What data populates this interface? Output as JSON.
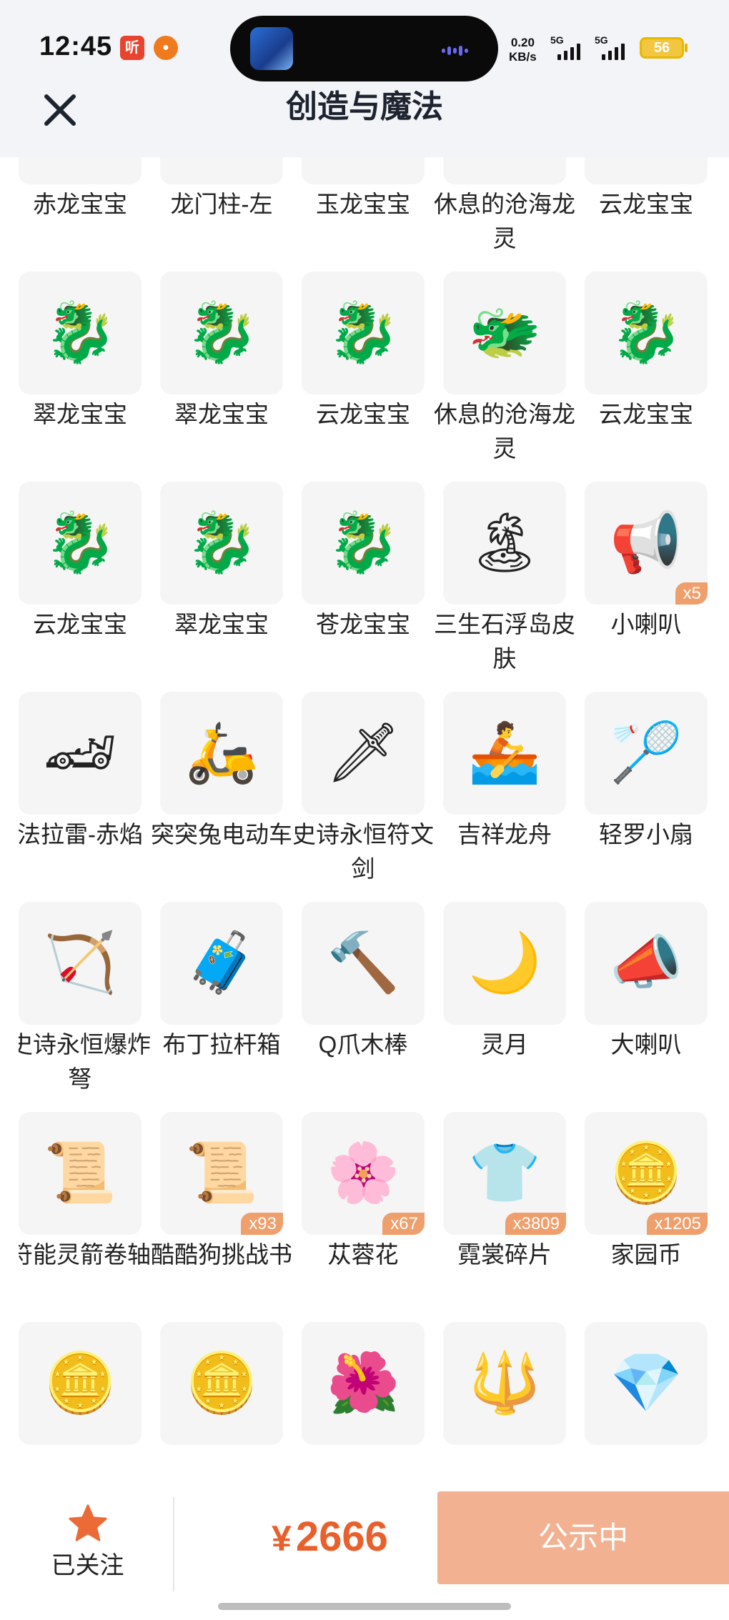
{
  "status_bar": {
    "time": "12:45",
    "badge1": "听",
    "network_speed": "0.20",
    "network_unit": "KB/s",
    "sim1": "5G",
    "sim2": "5G",
    "battery": "56"
  },
  "nav": {
    "close_icon": "close-icon",
    "title": "创造与魔法"
  },
  "items": [
    {
      "name": "赤龙宝宝",
      "icon": "🐉",
      "qty": ""
    },
    {
      "name": "龙门柱-左",
      "icon": "🏮",
      "qty": ""
    },
    {
      "name": "玉龙宝宝",
      "icon": "🐉",
      "qty": ""
    },
    {
      "name": "休息的沧海龙灵",
      "icon": "🐲",
      "qty": ""
    },
    {
      "name": "云龙宝宝",
      "icon": "🐉",
      "qty": ""
    },
    {
      "name": "翠龙宝宝",
      "icon": "🐉",
      "qty": ""
    },
    {
      "name": "翠龙宝宝",
      "icon": "🐉",
      "qty": ""
    },
    {
      "name": "云龙宝宝",
      "icon": "🐉",
      "qty": ""
    },
    {
      "name": "休息的沧海龙灵",
      "icon": "🐲",
      "qty": ""
    },
    {
      "name": "云龙宝宝",
      "icon": "🐉",
      "qty": ""
    },
    {
      "name": "云龙宝宝",
      "icon": "🐉",
      "qty": ""
    },
    {
      "name": "翠龙宝宝",
      "icon": "🐉",
      "qty": ""
    },
    {
      "name": "苍龙宝宝",
      "icon": "🐉",
      "qty": ""
    },
    {
      "name": "三生石浮岛皮肤",
      "icon": "🏝",
      "qty": ""
    },
    {
      "name": "小喇叭",
      "icon": "📢",
      "qty": "x5"
    },
    {
      "name": "法拉雷-赤焰",
      "icon": "🏎",
      "qty": ""
    },
    {
      "name": "突突兔电动车",
      "icon": "🛵",
      "qty": ""
    },
    {
      "name": "史诗永恒符文剑",
      "icon": "🗡",
      "qty": ""
    },
    {
      "name": "吉祥龙舟",
      "icon": "🚣",
      "qty": ""
    },
    {
      "name": "轻罗小扇",
      "icon": "🏸",
      "qty": ""
    },
    {
      "name": "史诗永恒爆炸弩",
      "icon": "🏹",
      "qty": ""
    },
    {
      "name": "布丁拉杆箱",
      "icon": "🧳",
      "qty": ""
    },
    {
      "name": "Q爪木棒",
      "icon": "🔨",
      "qty": ""
    },
    {
      "name": "灵月",
      "icon": "🌙",
      "qty": ""
    },
    {
      "name": "大喇叭",
      "icon": "📣",
      "qty": ""
    },
    {
      "name": "符能灵箭卷轴",
      "icon": "📜",
      "qty": ""
    },
    {
      "name": "酷酷狗挑战书",
      "icon": "📜",
      "qty": "x93"
    },
    {
      "name": "苁蓉花",
      "icon": "🌸",
      "qty": "x67"
    },
    {
      "name": "霓裳碎片",
      "icon": "👕",
      "qty": "x3809"
    },
    {
      "name": "家园币",
      "icon": "🪙",
      "qty": "x1205"
    },
    {
      "name": "",
      "icon": "🪙",
      "qty": ""
    },
    {
      "name": "",
      "icon": "🪙",
      "qty": ""
    },
    {
      "name": "",
      "icon": "🌺",
      "qty": ""
    },
    {
      "name": "",
      "icon": "🔱",
      "qty": ""
    },
    {
      "name": "",
      "icon": "💎",
      "qty": ""
    }
  ],
  "bottom": {
    "follow_label": "已关注",
    "currency": "¥",
    "price": "2666",
    "publish_label": "公示中"
  }
}
